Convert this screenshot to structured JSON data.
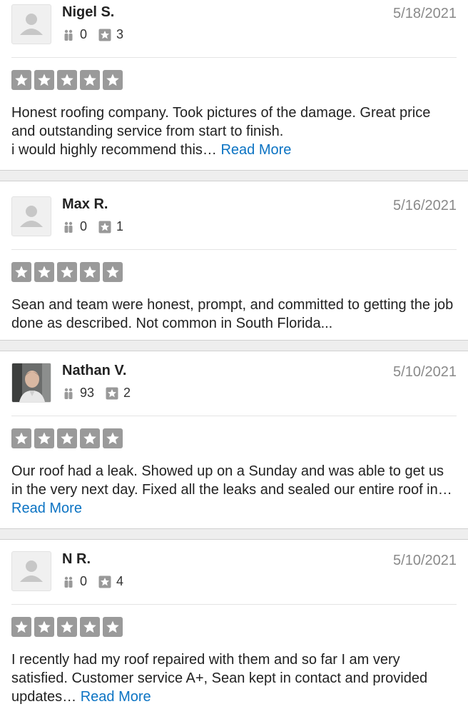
{
  "reviews": [
    {
      "user": "Nigel S.",
      "date": "5/18/2021",
      "friends": "0",
      "reviews": "3",
      "avatar": "default-avatar",
      "rating": 5,
      "text": "Honest roofing company. Took pictures of the damage. Great price and outstanding service from start to finish.\ni would highly recommend this… ",
      "read_more": "Read More"
    },
    {
      "user": "Max R.",
      "date": "5/16/2021",
      "friends": "0",
      "reviews": "1",
      "avatar": "default-avatar",
      "rating": 5,
      "text": "Sean and team were honest, prompt, and committed to getting the job done as described. Not common in South Florida...",
      "read_more": ""
    },
    {
      "user": "Nathan V.",
      "date": "5/10/2021",
      "friends": "93",
      "reviews": "2",
      "avatar": "photo-avatar",
      "rating": 5,
      "text": "Our roof had a leak. Showed up on a Sunday and was able to get us in the very next day. Fixed all the leaks and sealed our entire roof in… ",
      "read_more": "Read More"
    },
    {
      "user": "N R.",
      "date": "5/10/2021",
      "friends": "0",
      "reviews": "4",
      "avatar": "default-avatar",
      "rating": 5,
      "text": "I recently had my roof repaired with them and so far I am very satisfied. Customer service A+, Sean kept in contact and provided updates… ",
      "read_more": "Read More"
    }
  ],
  "colors": {
    "star_box": "#9a9a9a",
    "link": "#0b73c3",
    "date": "#8a8a8a"
  }
}
